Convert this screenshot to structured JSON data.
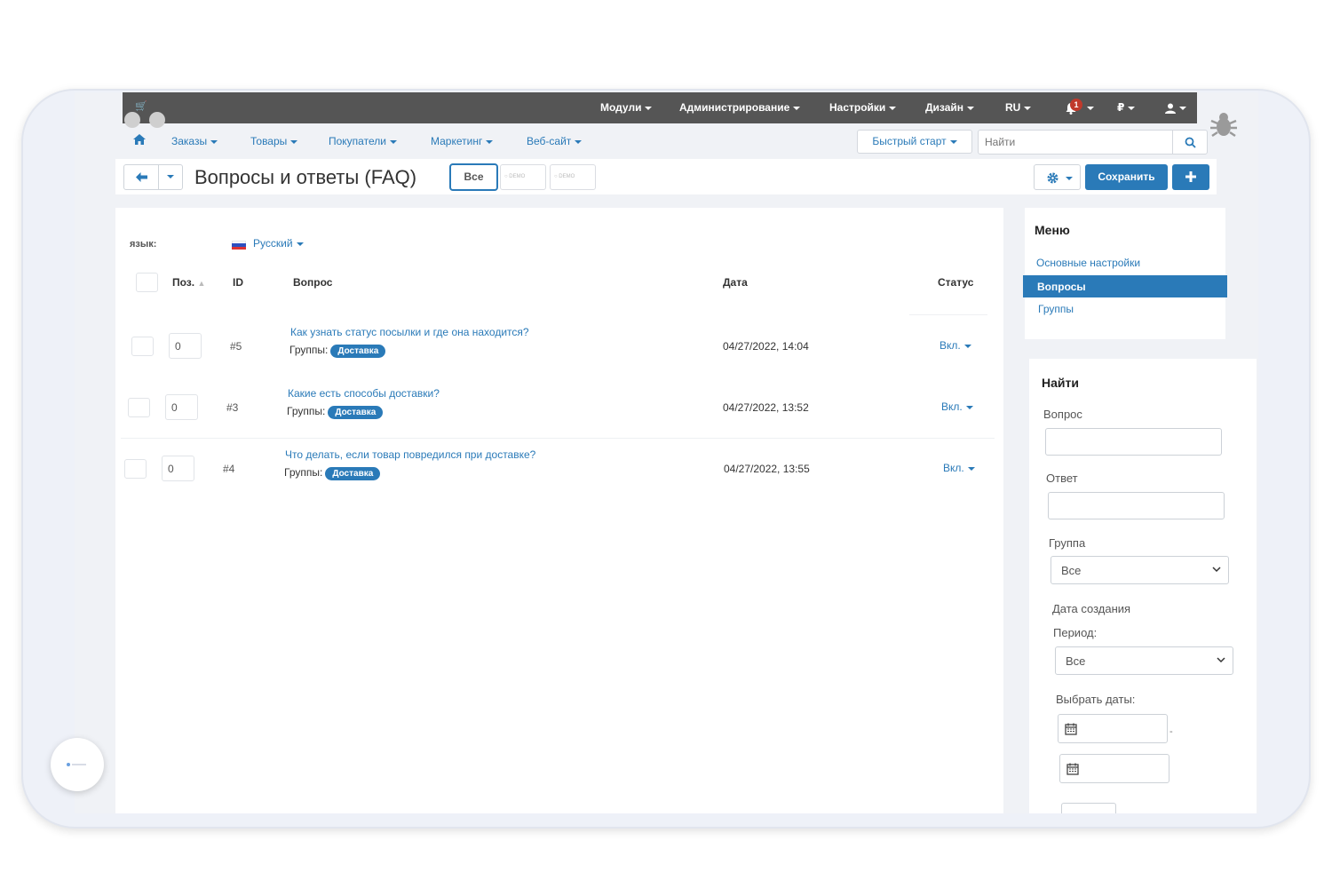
{
  "topbar": {
    "menus": [
      {
        "label": "Модули"
      },
      {
        "label": "Администрирование"
      },
      {
        "label": "Настройки"
      },
      {
        "label": "Дизайн"
      },
      {
        "label": "RU"
      },
      {
        "label": "₽"
      }
    ],
    "notification_count": "1"
  },
  "subnav": {
    "items": [
      {
        "label": "Заказы"
      },
      {
        "label": "Товары"
      },
      {
        "label": "Покупатели"
      },
      {
        "label": "Маркетинг"
      },
      {
        "label": "Веб-сайт"
      }
    ],
    "quick_start": "Быстрый старт",
    "search_placeholder": "Найти"
  },
  "header": {
    "title": "Вопросы и ответы (FAQ)",
    "filter_all": "Все",
    "demo_label": "DEMO",
    "save_label": "Сохранить"
  },
  "main": {
    "language_label": "язык:",
    "language_value": "Русский",
    "columns": {
      "pos": "Поз.",
      "id": "ID",
      "question": "Вопрос",
      "date": "Дата",
      "status": "Статус"
    },
    "groups_label": "Группы:",
    "rows": [
      {
        "pos": "0",
        "id": "#5",
        "question": "Как узнать статус посылки и где она находится?",
        "group": "Доставка",
        "date": "04/27/2022, 14:04",
        "status": "Вкл."
      },
      {
        "pos": "0",
        "id": "#3",
        "question": "Какие есть способы доставки?",
        "group": "Доставка",
        "date": "04/27/2022, 13:52",
        "status": "Вкл."
      },
      {
        "pos": "0",
        "id": "#4",
        "question": "Что делать, если товар повредился при доставке?",
        "group": "Доставка",
        "date": "04/27/2022, 13:55",
        "status": "Вкл."
      }
    ]
  },
  "sidebar_menu": {
    "title": "Меню",
    "items": [
      {
        "label": "Основные настройки"
      },
      {
        "label": "Вопросы"
      },
      {
        "label": "Группы"
      }
    ],
    "active": "Вопросы"
  },
  "find": {
    "title": "Найти",
    "question_label": "Вопрос",
    "answer_label": "Ответ",
    "group_label": "Группа",
    "group_value": "Все",
    "created_label": "Дата создания",
    "period_label": "Период:",
    "period_value": "Все",
    "dates_label": "Выбрать даты:",
    "dates_separator": "-"
  },
  "colors": {
    "accent": "#2a7ab8",
    "topbar": "#555555",
    "badge": "#c0392b"
  }
}
